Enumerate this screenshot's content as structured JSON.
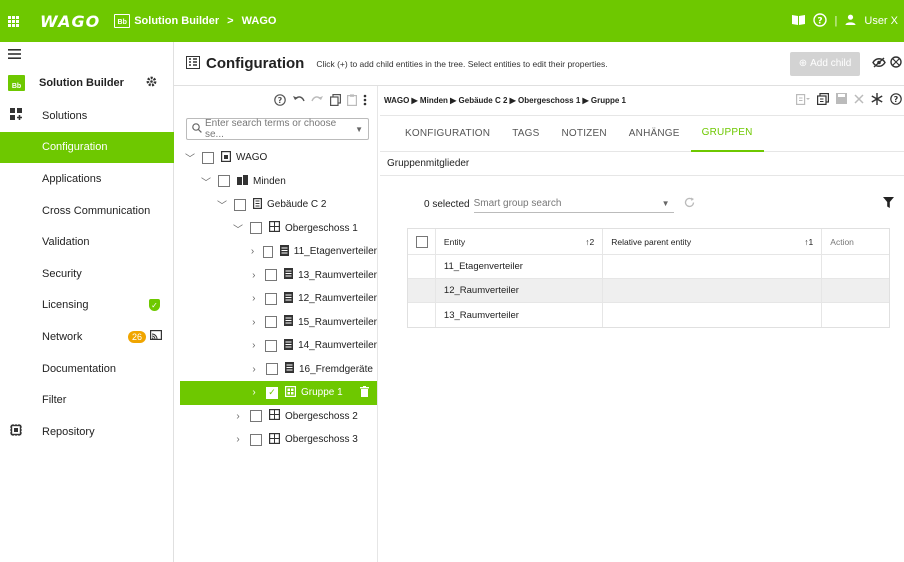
{
  "topbar": {
    "apps_icon": "grid-apps-icon",
    "logo": "WAGO",
    "app_icon_text": "Bb",
    "crumbs": [
      "Solution Builder",
      ">",
      "WAGO"
    ],
    "book_icon": "book-icon",
    "help_icon": "help-icon",
    "separator": "|",
    "user_label": "User X",
    "accent": "#6ec800"
  },
  "sidebar": {
    "title": "Solution Builder",
    "items": [
      {
        "label": "Solutions",
        "icon": "solutions-icon"
      },
      {
        "label": "Configuration",
        "active": true
      },
      {
        "label": "Applications"
      },
      {
        "label": "Cross Communication"
      },
      {
        "label": "Validation"
      },
      {
        "label": "Security"
      },
      {
        "label": "Licensing",
        "status": "shield-check-icon"
      },
      {
        "label": "Network",
        "badge": "26",
        "status": "cast-icon"
      },
      {
        "label": "Documentation"
      },
      {
        "label": "Filter"
      },
      {
        "label": "Repository",
        "icon": "repository-icon"
      }
    ]
  },
  "page": {
    "title": "Configuration",
    "hint": "Click (+) to add child entities in the tree. Select entities to edit their properties.",
    "add_child": "Add child"
  },
  "tree": {
    "search_placeholder": "Enter search terms or choose se...",
    "nodes": [
      {
        "label": "WAGO",
        "level": 0,
        "expanded": true
      },
      {
        "label": "Minden",
        "level": 1,
        "expanded": true
      },
      {
        "label": "Gebäude C 2",
        "level": 2,
        "expanded": true
      },
      {
        "label": "Obergeschoss 1",
        "level": 3,
        "expanded": true
      },
      {
        "label": "11_Etagenverteiler",
        "level": 4
      },
      {
        "label": "13_Raumverteiler",
        "level": 4
      },
      {
        "label": "12_Raumverteiler",
        "level": 4
      },
      {
        "label": "15_Raumverteiler",
        "level": 4
      },
      {
        "label": "14_Raumverteiler",
        "level": 4
      },
      {
        "label": "16_Fremdgeräte",
        "level": 4
      },
      {
        "label": "Gruppe 1",
        "level": 4,
        "selected": true
      },
      {
        "label": "Obergeschoss 2",
        "level": 3
      },
      {
        "label": "Obergeschoss 3",
        "level": 3
      }
    ]
  },
  "detail": {
    "breadcrumb": "WAGO ▶ Minden ▶ Gebäude C 2 ▶ Obergeschoss 1 ▶ Gruppe 1",
    "tabs": [
      "KONFIGURATION",
      "TAGS",
      "NOTIZEN",
      "ANHÄNGE",
      "GRUPPEN"
    ],
    "active_tab": "GRUPPEN",
    "section": "Gruppenmitglieder",
    "selected_count": "0 selected",
    "group_search_placeholder": "Smart group search",
    "columns": [
      {
        "label": "Entity",
        "sort": "↑2"
      },
      {
        "label": "Relative parent entity",
        "sort": "↑1"
      },
      {
        "label": "Action"
      }
    ],
    "rows": [
      {
        "entity": "11_Etagenverteiler",
        "parent": "",
        "action": ""
      },
      {
        "entity": "12_Raumverteiler",
        "parent": "",
        "action": ""
      },
      {
        "entity": "13_Raumverteiler",
        "parent": "",
        "action": ""
      }
    ]
  }
}
